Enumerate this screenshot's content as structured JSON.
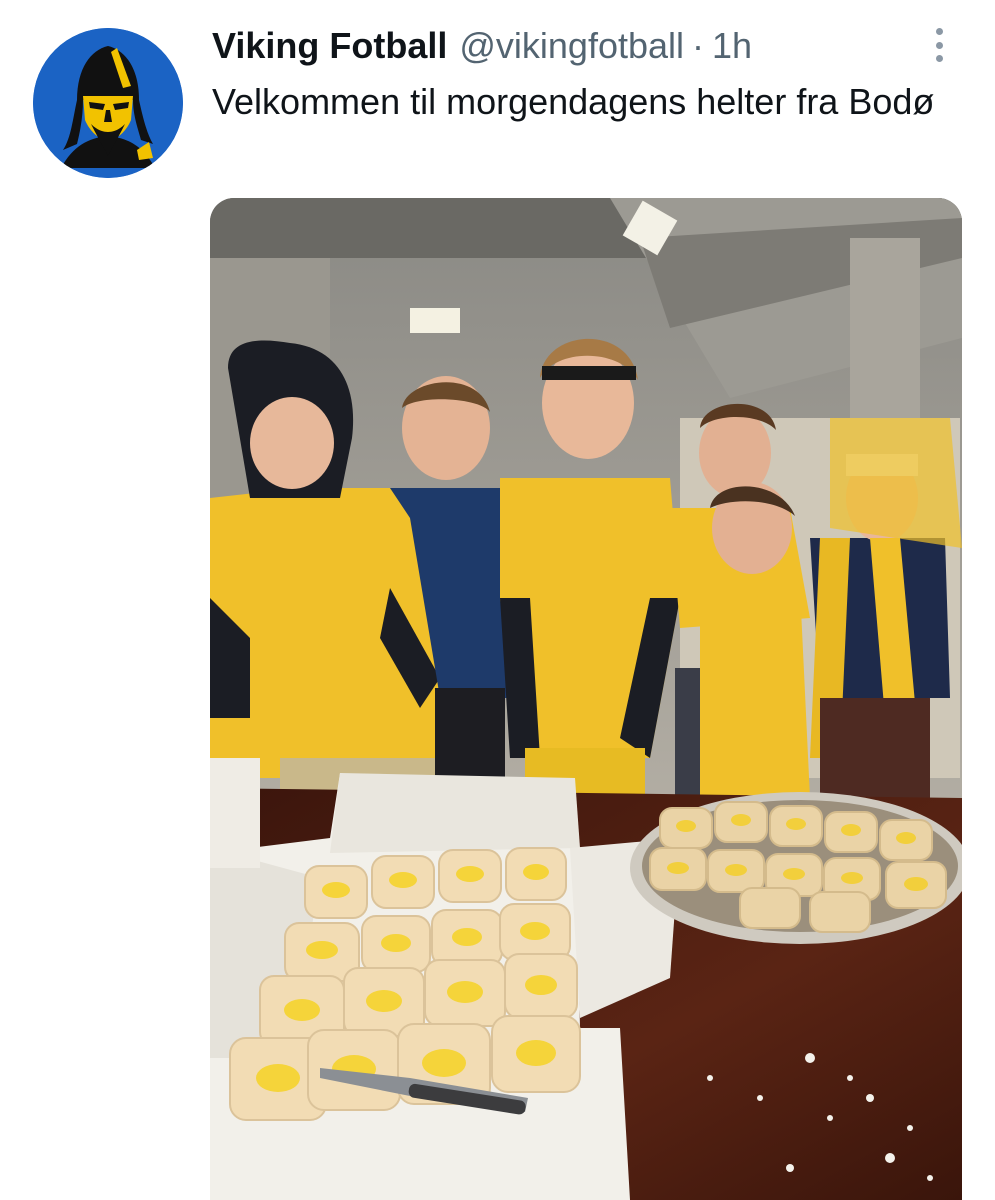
{
  "tweet": {
    "display_name": "Viking Fotball",
    "handle": "@vikingfotball",
    "separator": "·",
    "time": "1h",
    "text": "Velkommen til morgendagens helter fra Bodø"
  },
  "avatar": {
    "icon": "viking-logo-icon",
    "colors": {
      "background": "#1b63c4",
      "figure": "#111111",
      "accent": "#f2c200"
    }
  },
  "media": {
    "icon": "photo-image",
    "colors": {
      "jersey": "#f0c02a",
      "table": "#4a1e12",
      "box": "#f1efe9"
    }
  },
  "more": {
    "icon": "more-options-icon"
  }
}
